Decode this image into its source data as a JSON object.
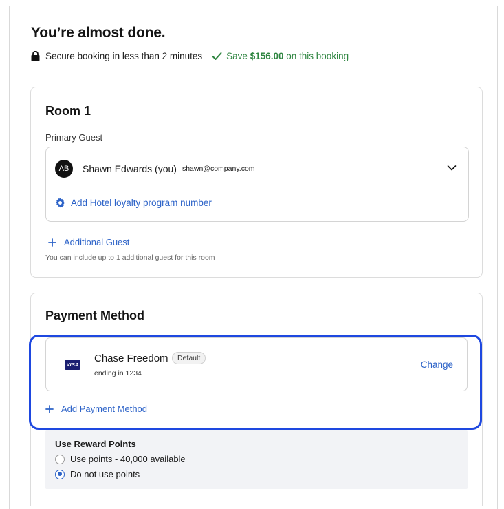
{
  "header": {
    "title": "You’re almost done.",
    "secure_text": "Secure booking in less than 2 minutes",
    "save_prefix": "Save",
    "save_amount": "$156.00",
    "save_suffix": "on this booking"
  },
  "room": {
    "title": "Room 1",
    "primary_guest_label": "Primary Guest",
    "guest": {
      "initials": "AB",
      "name": "Shawn Edwards (you)",
      "email": "shawn@company.com"
    },
    "loyalty_link": "Add Hotel loyalty program number",
    "additional_guest_link": "Additional Guest",
    "additional_guest_hint": "You can include up to 1 additional guest for this room"
  },
  "payment": {
    "title": "Payment Method",
    "card": {
      "brand": "VISA",
      "name": "Chase Freedom",
      "badge": "Default",
      "ending": "ending in 1234",
      "change_label": "Change"
    },
    "add_method_link": "Add Payment Method",
    "rewards": {
      "title": "Use Reward Points",
      "options": [
        {
          "label": "Use points - 40,000 available",
          "selected": false
        },
        {
          "label": "Do not use points",
          "selected": true
        }
      ]
    }
  },
  "colors": {
    "link": "#2d63c8",
    "success": "#2e8540",
    "highlight": "#1e48e0",
    "visa": "#1a1f71"
  }
}
